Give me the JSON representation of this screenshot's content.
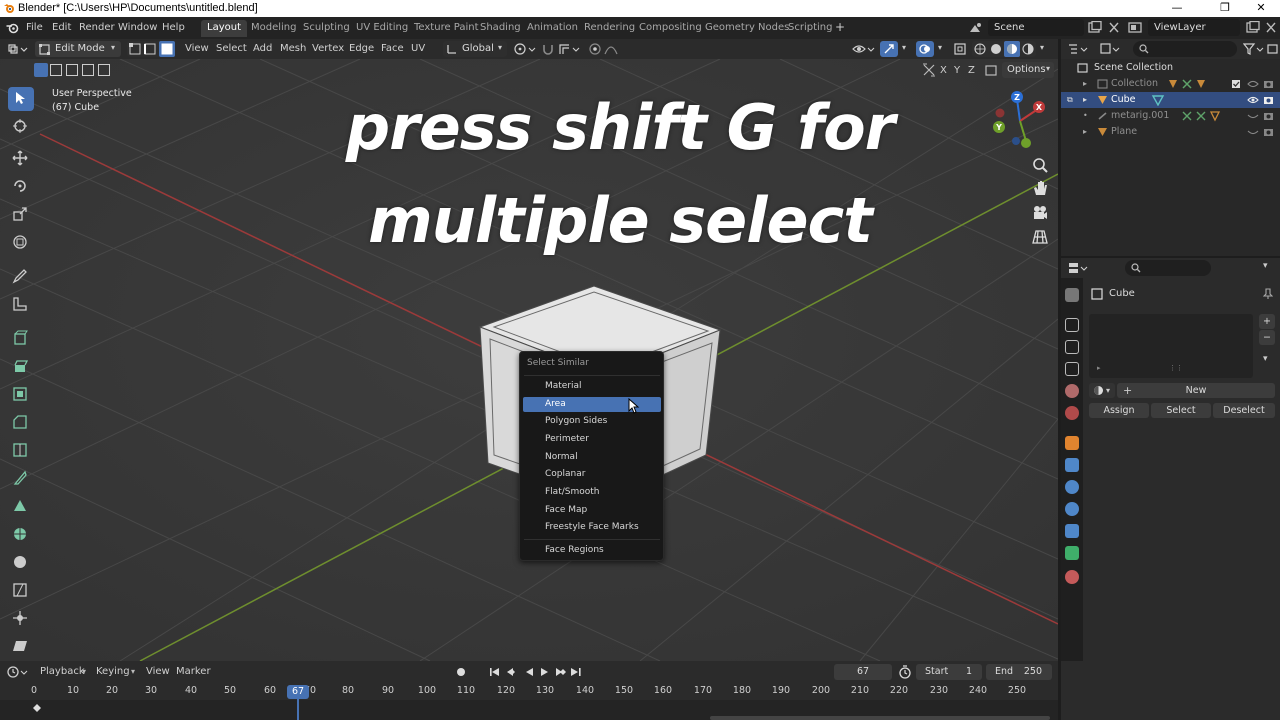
{
  "window": {
    "title": "Blender* [C:\\Users\\HP\\Documents\\untitled.blend]",
    "minimize": "—",
    "maximize": "❐",
    "close": "✕"
  },
  "menu": {
    "file": "File",
    "edit": "Edit",
    "render": "Render",
    "window": "Window",
    "help": "Help"
  },
  "workspaces": [
    "Layout",
    "Modeling",
    "Sculpting",
    "UV Editing",
    "Texture Paint",
    "Shading",
    "Animation",
    "Rendering",
    "Compositing",
    "Geometry Nodes",
    "Scripting"
  ],
  "active_workspace": "Layout",
  "add_workspace": "+",
  "scene": {
    "label": "Scene"
  },
  "view_layer": {
    "label": "ViewLayer"
  },
  "viewport_header": {
    "mode": "Edit Mode",
    "menus": [
      "View",
      "Select",
      "Add",
      "Mesh",
      "Vertex",
      "Edge",
      "Face",
      "UV"
    ],
    "orientation": "Global",
    "axes": [
      "X",
      "Y",
      "Z"
    ],
    "options": "Options"
  },
  "viewport": {
    "perspective": "User Perspective",
    "object_info": "(67) Cube",
    "overlay_text_line1": "press shift G for",
    "overlay_text_line2": "multiple select"
  },
  "select_similar_menu": {
    "title": "Select Similar",
    "items": [
      "Material",
      "Area",
      "Polygon Sides",
      "Perimeter",
      "Normal",
      "Coplanar",
      "Flat/Smooth",
      "Face Map",
      "Freestyle Face Marks"
    ],
    "highlighted": "Area",
    "extra_item": "Face Regions"
  },
  "outliner": {
    "root": "Scene Collection",
    "rows": [
      {
        "label": "Collection"
      },
      {
        "label": "Cube"
      },
      {
        "label": "metarig.001"
      },
      {
        "label": "Plane"
      }
    ]
  },
  "properties": {
    "object_name": "Cube",
    "new_label": "New",
    "assign": "Assign",
    "select": "Select",
    "deselect": "Deselect",
    "plus": "+",
    "minus": "−"
  },
  "timeline": {
    "menus": [
      "Playback",
      "Keying",
      "View",
      "Marker"
    ],
    "current_frame": "67",
    "start_label": "Start",
    "start_value": "1",
    "end_label": "End",
    "end_value": "250",
    "ticks": [
      "0",
      "10",
      "20",
      "30",
      "40",
      "50",
      "60",
      "70",
      "80",
      "90",
      "100",
      "110",
      "120",
      "130",
      "140",
      "150",
      "160",
      "170",
      "180",
      "190",
      "200",
      "210",
      "220",
      "230",
      "240",
      "250"
    ]
  },
  "colors": {
    "accent": "#4772b3",
    "x_axis": "#9b3a3a",
    "y_axis": "#6e8e2e",
    "outliner_selected": "#334d80"
  }
}
